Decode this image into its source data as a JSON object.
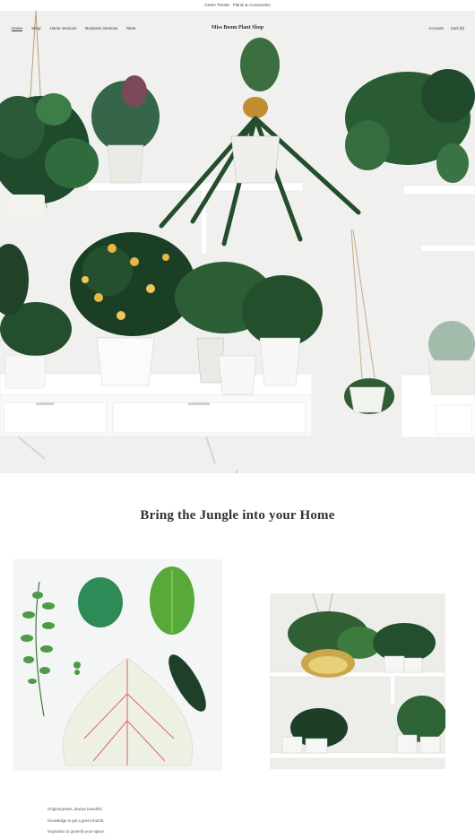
{
  "announcement": "Green Trends · Plants & Accessories",
  "nav": {
    "items": [
      {
        "label": "Home",
        "active": true
      },
      {
        "label": "Shop",
        "active": false
      },
      {
        "label": "Home services",
        "active": false
      },
      {
        "label": "Business services",
        "active": false
      },
      {
        "label": "More",
        "active": false
      }
    ],
    "brand": "Miss Boom Plant Shop",
    "account_label": "Account",
    "cart_label": "Cart (0)"
  },
  "hero": {
    "scroll_icon": "arrow-down-icon",
    "scroll_glyph": "↓"
  },
  "section": {
    "headline": "Bring the Jungle into your Home"
  },
  "gallery": {
    "left_image": "leaves-flatlay",
    "right_image": "plants-on-shelves"
  },
  "blurb": {
    "lines": [
      "Original plants, always beautiful.",
      "Knowledge to get a green thumb,",
      "inspiration to greenify your space."
    ]
  },
  "colors": {
    "leaf_dark": "#1f4a2c",
    "leaf_mid": "#2f6b3c",
    "pot_white": "#f7f7f5",
    "shelf_white": "#ffffff",
    "fruit_yellow": "#e8b64a",
    "headline": "#333333"
  }
}
